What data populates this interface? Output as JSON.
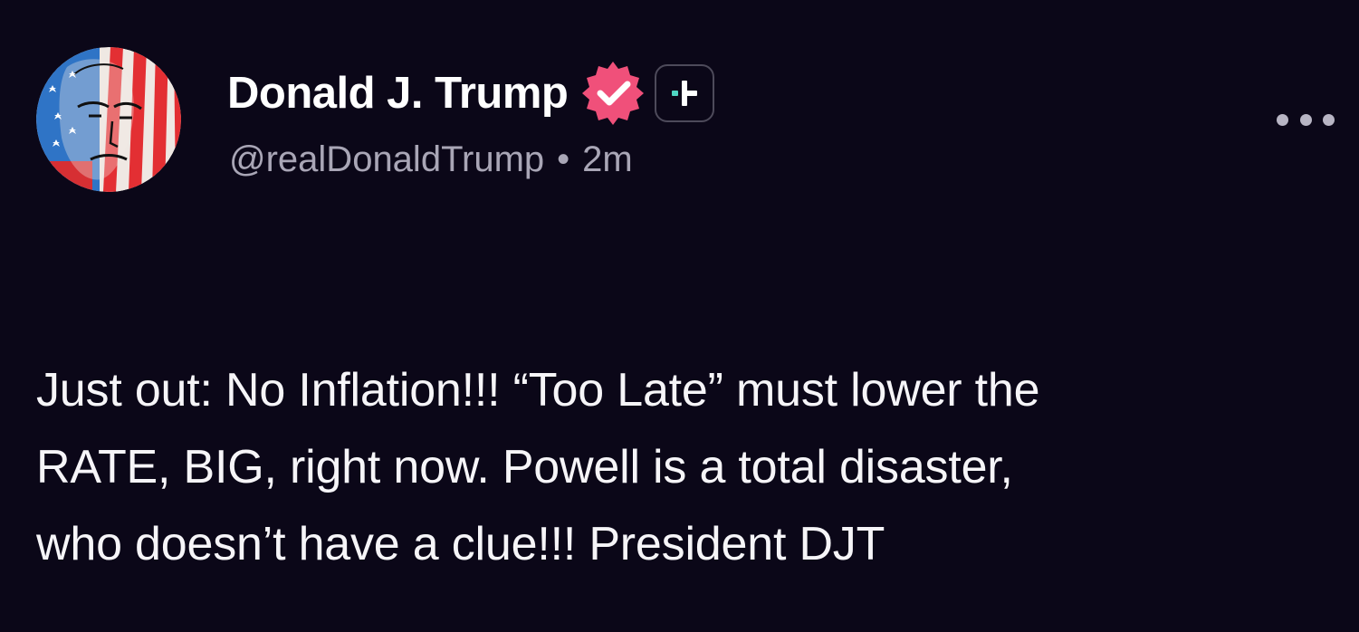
{
  "post": {
    "author": {
      "display_name": "Donald J. Trump",
      "handle": "@realDonaldTrump",
      "time_ago": "2m",
      "separator": "•"
    },
    "badges": [
      "verified-icon",
      "plus-icon"
    ],
    "menu_icon": "more-options-icon",
    "body_lines": [
      "Just out: No Inflation!!! “Too Late” must lower the",
      "RATE, BIG, right now. Powell is a total disaster,",
      "who doesn’t have a clue!!! President DJT"
    ]
  },
  "colors": {
    "background": "#0b0718",
    "verified_badge": "#f0507a",
    "plus_badge_accent": "#4fd6c3",
    "secondary_text": "#a9a6b6"
  }
}
